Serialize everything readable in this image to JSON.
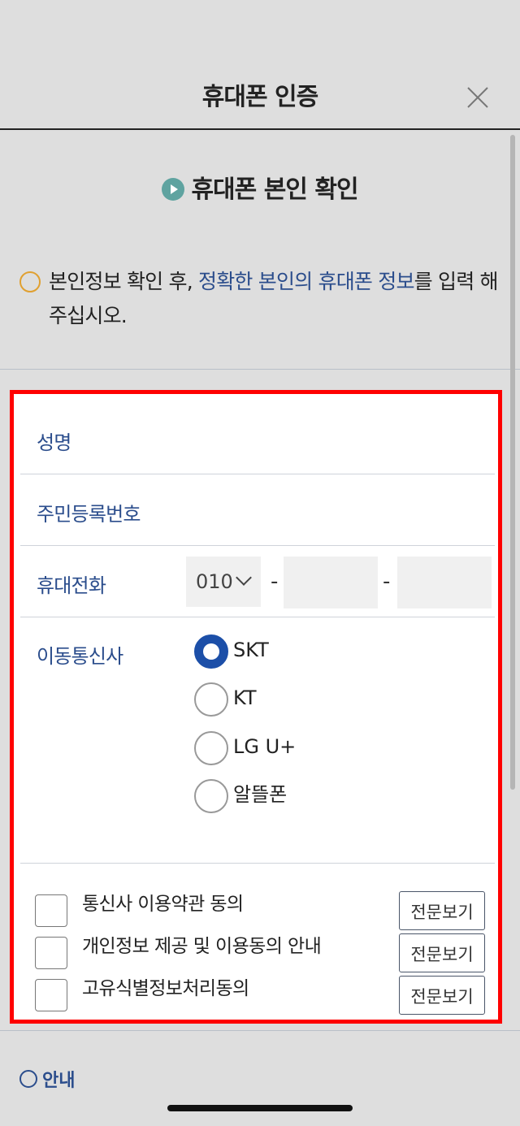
{
  "header": {
    "title": "휴대폰 인증",
    "close_icon": "close-icon"
  },
  "section": {
    "title": "휴대폰 본인 확인",
    "icon": "play-circle-icon"
  },
  "notice": {
    "icon": "speaker-icon",
    "prefix": "본인정보 확인 후, ",
    "highlight": "정확한 본인의 휴대폰 정보",
    "suffix": "를 입력 해 주십시오."
  },
  "form": {
    "name_label": "성명",
    "rrn_label": "주민등록번호",
    "phone_label": "휴대전화",
    "phone_prefix": "010",
    "phone_dash": "-",
    "carrier_label": "이동통신사",
    "carriers": [
      {
        "label": "SKT",
        "selected": true
      },
      {
        "label": "KT",
        "selected": false
      },
      {
        "label": "LG U+",
        "selected": false
      },
      {
        "label": "알뜰폰",
        "selected": false
      }
    ]
  },
  "agreements": [
    {
      "label": "통신사 이용약관 동의",
      "button": "전문보기"
    },
    {
      "label": "개인정보 제공 및 이용동의 안내",
      "button": "전문보기"
    },
    {
      "label": "고유식별정보처리동의",
      "button": "전문보기"
    }
  ],
  "bottom_notice": {
    "text": "안내"
  },
  "colors": {
    "accent": "#2b4d8c",
    "radio_selected": "#1c4fa8",
    "highlight_border": "#ff0000"
  }
}
